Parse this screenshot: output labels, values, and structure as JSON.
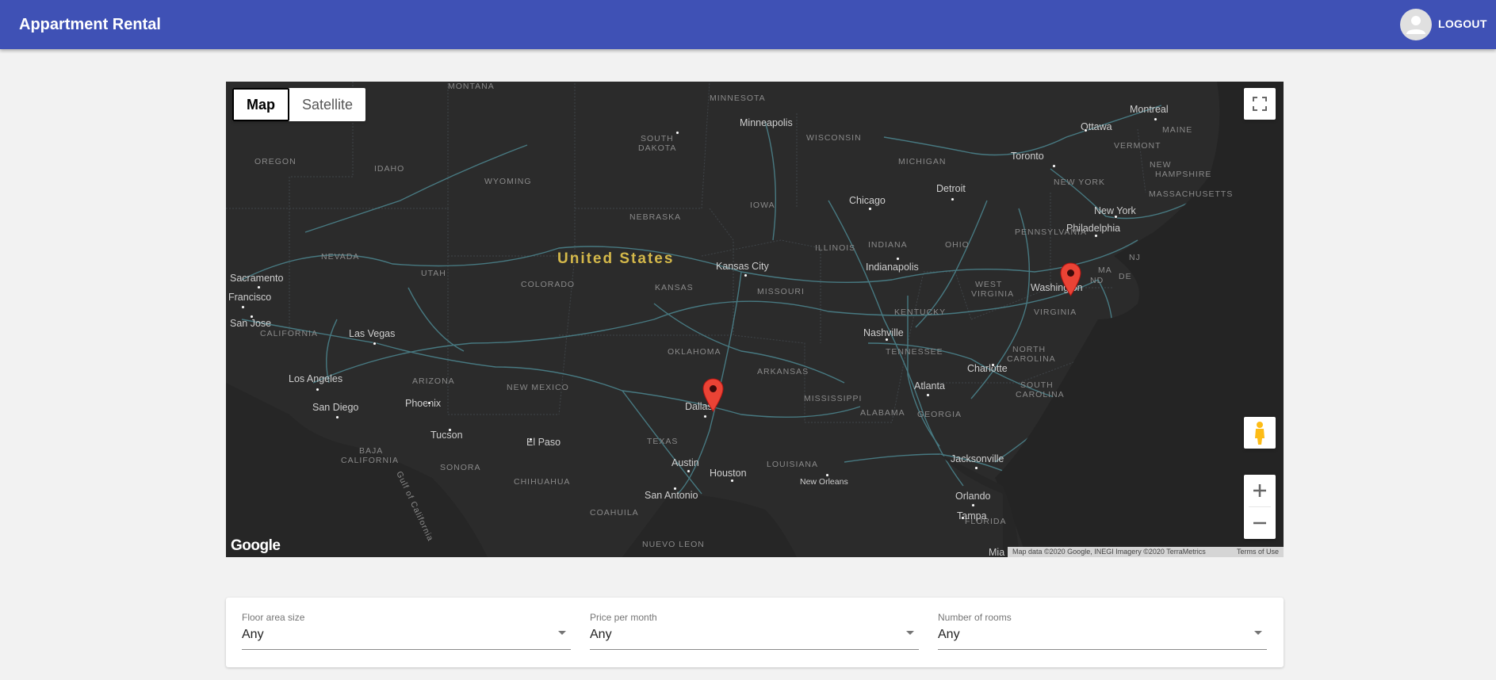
{
  "header": {
    "title": "Appartment Rental",
    "logout_label": "LOGOUT"
  },
  "map": {
    "map_type_options": [
      "Map",
      "Satellite"
    ],
    "selected_map_type": "Map",
    "country_label": "United States",
    "logo": "Google",
    "attribution": "Map data ©2020 Google, INEGI Imagery ©2020 TerraMetrics",
    "terms": "Terms of Use",
    "controls": {
      "fullscreen_icon": "fullscreen-icon",
      "pegman_icon": "pegman-icon",
      "zoom_in": "+",
      "zoom_out": "−"
    },
    "region_labels": [
      {
        "id": "montana",
        "text": "MONTANA"
      },
      {
        "id": "minnesota",
        "text": "MINNESOTA"
      },
      {
        "id": "south-dakota-1",
        "text": "SOUTH"
      },
      {
        "id": "south-dakota-2",
        "text": "DAKOTA"
      },
      {
        "id": "wisconsin",
        "text": "WISCONSIN"
      },
      {
        "id": "michigan",
        "text": "MICHIGAN"
      },
      {
        "id": "oregon",
        "text": "OREGON"
      },
      {
        "id": "idaho",
        "text": "IDAHO"
      },
      {
        "id": "wyoming",
        "text": "WYOMING"
      },
      {
        "id": "iowa",
        "text": "IOWA"
      },
      {
        "id": "nebraska",
        "text": "NEBRASKA"
      },
      {
        "id": "nevada",
        "text": "NEVADA"
      },
      {
        "id": "utah",
        "text": "UTAH"
      },
      {
        "id": "colorado",
        "text": "COLORADO"
      },
      {
        "id": "kansas",
        "text": "KANSAS"
      },
      {
        "id": "illinois",
        "text": "ILLINOIS"
      },
      {
        "id": "indiana",
        "text": "INDIANA"
      },
      {
        "id": "ohio",
        "text": "OHIO"
      },
      {
        "id": "pennsylvania",
        "text": "PENNSYLVANIA"
      },
      {
        "id": "new-york",
        "text": "NEW YORK"
      },
      {
        "id": "vermont",
        "text": "VERMONT"
      },
      {
        "id": "maine",
        "text": "MAINE"
      },
      {
        "id": "new-hampshire-1",
        "text": "NEW"
      },
      {
        "id": "new-hampshire-2",
        "text": "HAMPSHIRE"
      },
      {
        "id": "massachusetts",
        "text": "MASSACHUSETTS"
      },
      {
        "id": "missouri",
        "text": "MISSOURI"
      },
      {
        "id": "west-virginia-1",
        "text": "WEST"
      },
      {
        "id": "west-virginia-2",
        "text": "VIRGINIA"
      },
      {
        "id": "kentucky",
        "text": "KENTUCKY"
      },
      {
        "id": "virginia",
        "text": "VIRGINIA"
      },
      {
        "id": "maryland-1",
        "text": "MA"
      },
      {
        "id": "maryland-2",
        "text": "ND"
      },
      {
        "id": "delaware",
        "text": "DE"
      },
      {
        "id": "new-jersey",
        "text": "NJ"
      },
      {
        "id": "california",
        "text": "CALIFORNIA"
      },
      {
        "id": "arizona",
        "text": "ARIZONA"
      },
      {
        "id": "new-mexico",
        "text": "NEW MEXICO"
      },
      {
        "id": "oklahoma",
        "text": "OKLAHOMA"
      },
      {
        "id": "arkansas",
        "text": "ARKANSAS"
      },
      {
        "id": "tennessee",
        "text": "TENNESSEE"
      },
      {
        "id": "north-carolina-1",
        "text": "NORTH"
      },
      {
        "id": "north-carolina-2",
        "text": "CAROLINA"
      },
      {
        "id": "south-carolina-1",
        "text": "SOUTH"
      },
      {
        "id": "south-carolina-2",
        "text": "CAROLINA"
      },
      {
        "id": "mississippi",
        "text": "MISSISSIPPI"
      },
      {
        "id": "alabama",
        "text": "ALABAMA"
      },
      {
        "id": "georgia",
        "text": "GEORGIA"
      },
      {
        "id": "texas",
        "text": "TEXAS"
      },
      {
        "id": "louisiana",
        "text": "LOUISIANA"
      },
      {
        "id": "florida",
        "text": "FLORIDA"
      },
      {
        "id": "baja-california-1",
        "text": "BAJA"
      },
      {
        "id": "baja-california-2",
        "text": "CALIFORNIA"
      },
      {
        "id": "sonora",
        "text": "SONORA"
      },
      {
        "id": "chihuahua",
        "text": "CHIHUAHUA"
      },
      {
        "id": "coahuila",
        "text": "COAHUILA"
      },
      {
        "id": "nuevo-leon",
        "text": "NUEVO LEON"
      },
      {
        "id": "gulf-of-california",
        "text": "Gulf of California"
      }
    ],
    "city_labels": [
      {
        "id": "minneapolis",
        "text": "Minneapolis"
      },
      {
        "id": "ottawa",
        "text": "Ottawa"
      },
      {
        "id": "montreal",
        "text": "Montreal"
      },
      {
        "id": "toronto",
        "text": "Toronto"
      },
      {
        "id": "chicago",
        "text": "Chicago"
      },
      {
        "id": "detroit",
        "text": "Detroit"
      },
      {
        "id": "new-york-city",
        "text": "New York"
      },
      {
        "id": "philadelphia",
        "text": "Philadelphia"
      },
      {
        "id": "washington",
        "text": "Washington"
      },
      {
        "id": "kansas-city",
        "text": "Kansas City"
      },
      {
        "id": "indianapolis",
        "text": "Indianapolis"
      },
      {
        "id": "sacramento",
        "text": "Sacramento"
      },
      {
        "id": "san-francisco",
        "text": "Francisco"
      },
      {
        "id": "san-jose",
        "text": "San Jose"
      },
      {
        "id": "las-vegas",
        "text": "Las Vegas"
      },
      {
        "id": "los-angeles",
        "text": "Los Angeles"
      },
      {
        "id": "san-diego",
        "text": "San Diego"
      },
      {
        "id": "phoenix",
        "text": "Phoenix"
      },
      {
        "id": "tucson",
        "text": "Tucson"
      },
      {
        "id": "el-paso",
        "text": "El Paso"
      },
      {
        "id": "dallas",
        "text": "Dallas"
      },
      {
        "id": "austin",
        "text": "Austin"
      },
      {
        "id": "houston",
        "text": "Houston"
      },
      {
        "id": "san-antonio",
        "text": "San Antonio"
      },
      {
        "id": "nashville",
        "text": "Nashville"
      },
      {
        "id": "charlotte",
        "text": "Charlotte"
      },
      {
        "id": "atlanta",
        "text": "Atlanta"
      },
      {
        "id": "new-orleans",
        "text": "New Orleans"
      },
      {
        "id": "jacksonville",
        "text": "Jacksonville"
      },
      {
        "id": "orlando",
        "text": "Orlando"
      },
      {
        "id": "tampa",
        "text": "Tampa"
      },
      {
        "id": "miami",
        "text": "Mia"
      }
    ],
    "markers": [
      "Washington",
      "Dallas"
    ]
  },
  "filters": [
    {
      "label": "Floor area size",
      "value": "Any"
    },
    {
      "label": "Price per month",
      "value": "Any"
    },
    {
      "label": "Number of rooms",
      "value": "Any"
    }
  ],
  "colors": {
    "primary": "#3f51b5",
    "map_background": "#2b2b2b",
    "map_label": "#cccccc",
    "country_label": "#d4b84a",
    "road": "#4d8791",
    "marker": "#ea4335"
  }
}
